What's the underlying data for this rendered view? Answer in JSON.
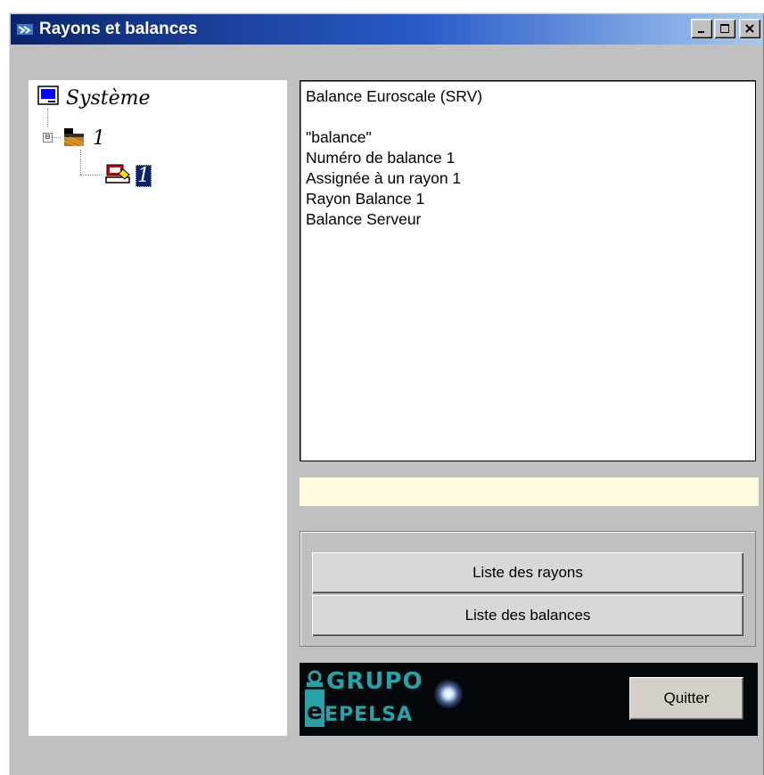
{
  "window": {
    "title": "Rayons et balances",
    "buttons": {
      "minimize": "_",
      "maximize": "□",
      "close": "×"
    }
  },
  "tree": {
    "root": {
      "label": "Système",
      "icon": "computer-icon"
    },
    "child": {
      "label": "1",
      "icon": "department-icon",
      "expander": "⊟"
    },
    "grandchild": {
      "label": "1",
      "icon": "scale-icon",
      "selected": true
    }
  },
  "info": {
    "lines": [
      "Balance Euroscale (SRV)",
      "",
      "\"balance\"",
      "Numéro de balance 1",
      "Assignée à un rayon 1",
      "Rayon Balance 1",
      "Balance Serveur"
    ]
  },
  "status": {
    "text": ""
  },
  "buttons": {
    "list_rayons": "Liste des rayons",
    "list_balances": "Liste des balances",
    "quit": "Quitter"
  },
  "logo": {
    "line1": "GRUPO",
    "line2": "EPELSA"
  },
  "colors": {
    "title_gradient_start": "#0a246a",
    "title_gradient_end": "#a6caf0",
    "window_bg": "#c0c0c0",
    "status_field_bg": "#fffbe0",
    "selection_bg": "#0a246a",
    "logo_text": "#27a3a8"
  }
}
